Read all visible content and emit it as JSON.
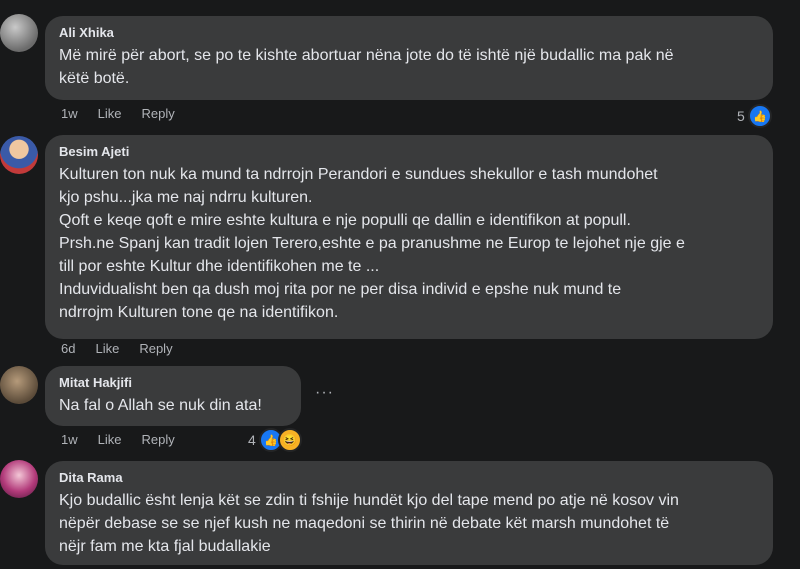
{
  "comments": [
    {
      "author": "Ali Xhika",
      "text": "Më mirë për abort, se po te kishte abortuar nëna jote do të ishtë një budallic ma pak në\nkëtë botë.",
      "time": "1w",
      "like": "Like",
      "reply": "Reply",
      "reaction_count": "5"
    },
    {
      "author": "Besim Ajeti",
      "text": "Kulturen ton nuk ka mund ta ndrrojn Perandori e sundues shekullor e tash mundohet\nkjo pshu...jka me naj ndrru kulturen.\nQoft e keqe qoft e mire eshte kultura e nje populli qe dallin e identifikon at popull.\nPrsh.ne Spanj kan tradit lojen Terero,eshte e pa pranushme ne Europ te lejohet nje gje e\ntill por eshte Kultur dhe identifikohen me te ...\nInduvidualisht ben qa dush moj rita por ne per disa individ e epshe nuk mund te\nndrrojm Kulturen tone qe na identifikon.",
      "time": "6d",
      "like": "Like",
      "reply": "Reply"
    },
    {
      "author": "Mitat Hakjifi",
      "text": "Na fal o Allah se nuk din ata!",
      "time": "1w",
      "like": "Like",
      "reply": "Reply",
      "reaction_count": "4",
      "more": "···"
    },
    {
      "author": "Dita Rama",
      "text": "Kjo budallic ësht lenja kët se zdin ti fshije hundët kjo del tape mend po atje në kosov vin\nnëpër debase se se njef kush ne maqedoni se thirin në debate kët marsh mundohet të\nnëjr fam me kta fjal budallakie"
    }
  ],
  "icons": {
    "like": "thumbs-up-icon",
    "haha": "haha-emoji-icon",
    "more": "more-options-icon"
  },
  "colors": {
    "background": "#18191a",
    "bubble": "#3a3b3c",
    "like_blue": "#1877f2",
    "meta_text": "#b0b3b8"
  }
}
